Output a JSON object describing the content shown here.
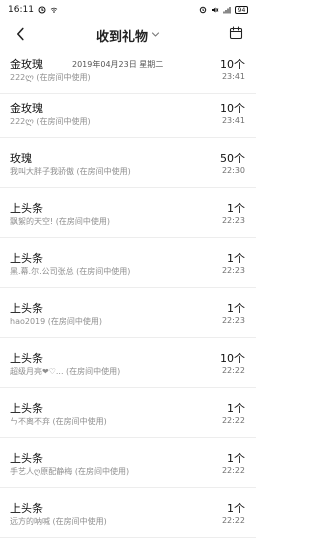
{
  "status_bar": {
    "time": "16:11",
    "battery": "94"
  },
  "header": {
    "title": "收到礼物"
  },
  "date_overlay": "2019年04月23日 星期二",
  "gifts": [
    {
      "name": "金玫瑰",
      "sender": "222ლ (在房间中使用)",
      "count": "10个",
      "time": "23:41"
    },
    {
      "name": "金玫瑰",
      "sender": "222ლ (在房间中使用)",
      "count": "10个",
      "time": "23:41"
    },
    {
      "name": "玫瑰",
      "sender": "我叫大胖子我骄傲 (在房间中使用)",
      "count": "50个",
      "time": "22:30"
    },
    {
      "name": "上头条",
      "sender": "飘絮的天空! (在房间中使用)",
      "count": "1个",
      "time": "22:23"
    },
    {
      "name": "上头条",
      "sender": "黑.幕.尔.公司张总 (在房间中使用)",
      "count": "1个",
      "time": "22:23"
    },
    {
      "name": "上头条",
      "sender": "hao2019 (在房间中使用)",
      "count": "1个",
      "time": "22:23"
    },
    {
      "name": "上头条",
      "sender": "超级月亮❤♡... (在房间中使用)",
      "count": "10个",
      "time": "22:22"
    },
    {
      "name": "上头条",
      "sender": "ㄣ不离不弃 (在房间中使用)",
      "count": "1个",
      "time": "22:22"
    },
    {
      "name": "上头条",
      "sender": "手艺人ღ原配静梅 (在房间中使用)",
      "count": "1个",
      "time": "22:22"
    },
    {
      "name": "上头条",
      "sender": "远方的呐喊 (在房间中使用)",
      "count": "1个",
      "time": "22:22"
    }
  ]
}
